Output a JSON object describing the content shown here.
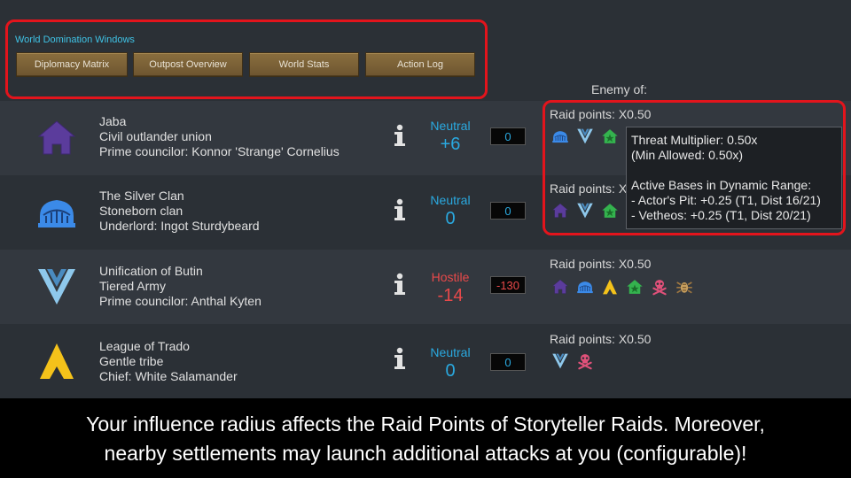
{
  "world_windows": {
    "title": "World Domination Windows",
    "buttons": [
      {
        "label": "Diplomacy Matrix"
      },
      {
        "label": "Outpost Overview"
      },
      {
        "label": "World Stats"
      },
      {
        "label": "Action Log"
      }
    ]
  },
  "enemy_of_header": "Enemy of:",
  "factions": [
    {
      "name": "Jaba",
      "type": "Civil outlander union",
      "leader": "Prime councilor: Konnor 'Strange' Cornelius",
      "icon": "house-icon",
      "relation": "Neutral",
      "goodwill": "+6",
      "goodwill_box": "0",
      "raid_points": "Raid points: X0.50",
      "enemy_icons": [
        "dome-icon",
        "chevron-icon",
        "house-star-icon"
      ]
    },
    {
      "name": "The Silver Clan",
      "type": "Stoneborn clan",
      "leader": "Underlord: Ingot Sturdybeard",
      "icon": "dome-icon",
      "relation": "Neutral",
      "goodwill": "0",
      "goodwill_box": "0",
      "raid_points": "Raid points: X0.50",
      "enemy_icons": [
        "house-icon",
        "chevron-icon",
        "house-star-icon"
      ]
    },
    {
      "name": "Unification of Butin",
      "type": "Tiered Army",
      "leader": "Prime councilor: Anthal Kyten",
      "icon": "chevron-icon",
      "relation": "Hostile",
      "goodwill": "-14",
      "goodwill_box": "-130",
      "raid_points": "Raid points: X0.50",
      "enemy_icons": [
        "house-icon",
        "dome-icon",
        "tent-icon",
        "house-star-icon",
        "skull-icon",
        "insect-icon"
      ]
    },
    {
      "name": "League of Trado",
      "type": "Gentle tribe",
      "leader": "Chief: White Salamander",
      "icon": "tent-icon",
      "relation": "Neutral",
      "goodwill": "0",
      "goodwill_box": "0",
      "raid_points": "Raid points: X0.50",
      "enemy_icons": [
        "chevron-icon",
        "skull-icon"
      ]
    }
  ],
  "tooltip": {
    "line1": "Threat Multiplier: 0.50x",
    "line2": "(Min Allowed: 0.50x)",
    "line3": "Active Bases in Dynamic Range:",
    "line4": "- Actor's Pit: +0.25 (T1, Dist 16/21)",
    "line5": "- Vetheos: +0.25 (T1, Dist 20/21)"
  },
  "caption": {
    "line1": "Your influence radius affects the Raid Points of Storyteller Raids. Moreover,",
    "line2": "nearby settlements may launch additional attacks at you (configurable)!"
  },
  "colors": {
    "neutral": "#2aa9e0",
    "hostile": "#e8494a",
    "highlight_box": "#e3141c",
    "purple": "#5b3c9c",
    "blue": "#3b8ae8",
    "green": "#34b34e",
    "yellow": "#f4c21a",
    "pink": "#e0517a"
  }
}
